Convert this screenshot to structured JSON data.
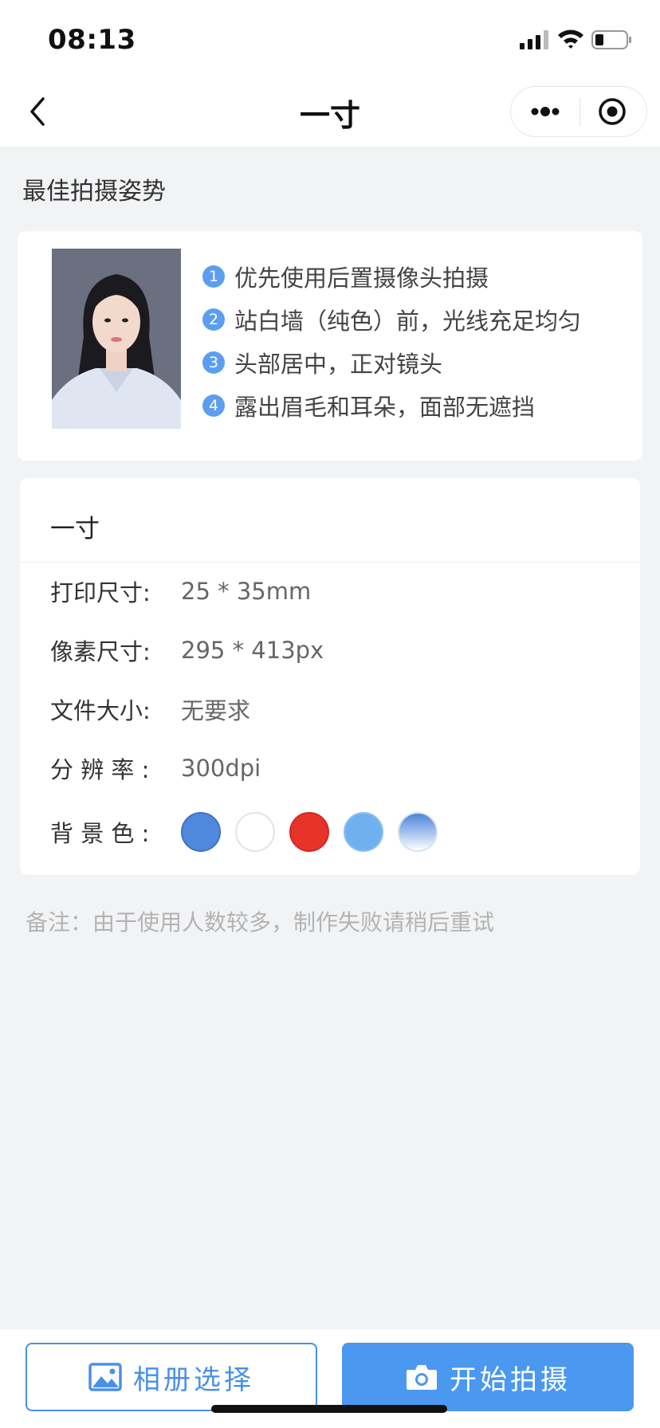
{
  "status_bar": {
    "time": "08:13"
  },
  "nav": {
    "title": "一寸"
  },
  "section_title": "最佳拍摄姿势",
  "tips": [
    {
      "num": "1",
      "text": "优先使用后置摄像头拍摄"
    },
    {
      "num": "2",
      "text": "站白墙（纯色）前，光线充足均匀"
    },
    {
      "num": "3",
      "text": "头部居中，正对镜头"
    },
    {
      "num": "4",
      "text": "露出眉毛和耳朵，面部无遮挡"
    }
  ],
  "spec": {
    "title": "一寸",
    "print_size": {
      "label": "打印尺寸:",
      "value": "25 * 35mm"
    },
    "pixel_size": {
      "label": "像素尺寸:",
      "value": "295 * 413px"
    },
    "file_size": {
      "label": "文件大小:",
      "value": "无要求"
    },
    "resolution": {
      "label": "分 辨 率 :",
      "value": "300dpi"
    },
    "background": {
      "label": "背 景 色 :",
      "colors": [
        "#4f88dc",
        "#ffffff",
        "#e8332b",
        "#6fb0ef",
        "gradient-blue"
      ]
    }
  },
  "note": "备注：由于使用人数较多，制作失败请稍后重试",
  "buttons": {
    "album": "相册选择",
    "shoot": "开始拍摄"
  },
  "icons": {
    "back": "chevron-left-icon",
    "more": "more-dots-icon",
    "close": "target-circle-icon",
    "album": "image-icon",
    "shoot": "camera-icon"
  }
}
